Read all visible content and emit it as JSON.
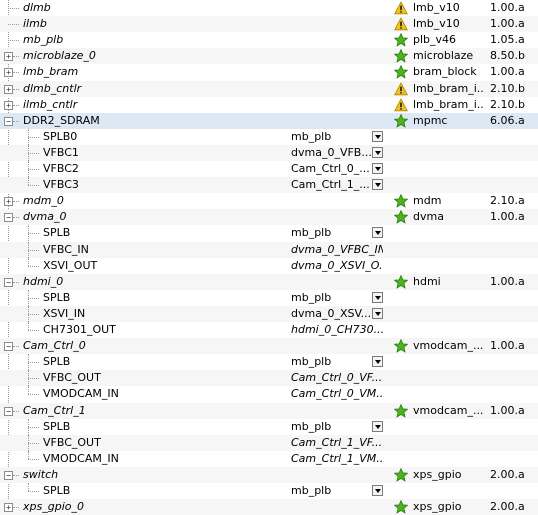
{
  "colors": {
    "star_fill": "#4bb41e",
    "star_stroke": "#2b7a0b",
    "warn_fill": "#f2c21b",
    "warn_stroke": "#b0860a",
    "selected_row": "#dde8f5"
  },
  "rows": [
    {
      "name": "dlmb",
      "italic": true,
      "level": 0,
      "expander": false,
      "status": "warning",
      "ip": "lmb_v10",
      "version": "1.00.a"
    },
    {
      "name": "ilmb",
      "italic": true,
      "level": 0,
      "expander": false,
      "status": "warning",
      "ip": "lmb_v10",
      "version": "1.00.a"
    },
    {
      "name": "mb_plb",
      "italic": true,
      "level": 0,
      "expander": false,
      "status": "star",
      "ip": "plb_v46",
      "version": "1.05.a"
    },
    {
      "name": "microblaze_0",
      "italic": true,
      "level": 0,
      "expander": true,
      "status": "star",
      "ip": "microblaze",
      "version": "8.50.b"
    },
    {
      "name": "lmb_bram",
      "italic": true,
      "level": 0,
      "expander": true,
      "status": "star",
      "ip": "bram_block",
      "version": "1.00.a"
    },
    {
      "name": "dlmb_cntlr",
      "italic": true,
      "level": 0,
      "expander": true,
      "status": "warning",
      "ip": "lmb_bram_i...",
      "version": "2.10.b"
    },
    {
      "name": "ilmb_cntlr",
      "italic": true,
      "level": 0,
      "expander": true,
      "status": "warning",
      "ip": "lmb_bram_i...",
      "version": "2.10.b"
    },
    {
      "name": "DDR2_SDRAM",
      "italic": false,
      "level": 0,
      "expander": true,
      "expanded": true,
      "status": "star",
      "ip": "mpmc",
      "version": "6.06.a",
      "selected": true
    },
    {
      "name": "SPLB0",
      "level": 1,
      "bus": "mb_plb",
      "dropdown": true
    },
    {
      "name": "VFBC1",
      "level": 1,
      "bus": "dvma_0_VFB...",
      "dropdown": true
    },
    {
      "name": "VFBC2",
      "level": 1,
      "bus": "Cam_Ctrl_0_...",
      "dropdown": true
    },
    {
      "name": "VFBC3",
      "level": 1,
      "bus": "Cam_Ctrl_1_...",
      "dropdown": true,
      "last": true
    },
    {
      "name": "mdm_0",
      "italic": true,
      "level": 0,
      "expander": true,
      "status": "star",
      "ip": "mdm",
      "version": "2.10.a"
    },
    {
      "name": "dvma_0",
      "italic": true,
      "level": 0,
      "expander": true,
      "expanded": true,
      "status": "star",
      "ip": "dvma",
      "version": "1.00.a"
    },
    {
      "name": "SPLB",
      "level": 1,
      "bus": "mb_plb",
      "dropdown": true
    },
    {
      "name": "VFBC_IN",
      "level": 1,
      "bus": "dvma_0_VFBC_IN",
      "bus_italic": true
    },
    {
      "name": "XSVI_OUT",
      "level": 1,
      "bus": "dvma_0_XSVI_O...",
      "bus_italic": true,
      "last": true
    },
    {
      "name": "hdmi_0",
      "italic": true,
      "level": 0,
      "expander": true,
      "expanded": true,
      "status": "star",
      "ip": "hdmi",
      "version": "1.00.a"
    },
    {
      "name": "SPLB",
      "level": 1,
      "bus": "mb_plb",
      "dropdown": true
    },
    {
      "name": "XSVI_IN",
      "level": 1,
      "bus": "dvma_0_XSV...",
      "dropdown": true
    },
    {
      "name": "CH7301_OUT",
      "level": 1,
      "bus": "hdmi_0_CH730...",
      "bus_italic": true,
      "last": true
    },
    {
      "name": "Cam_Ctrl_0",
      "italic": true,
      "level": 0,
      "expander": true,
      "expanded": true,
      "status": "star",
      "ip": "vmodcam_...",
      "version": "1.00.a"
    },
    {
      "name": "SPLB",
      "level": 1,
      "bus": "mb_plb",
      "dropdown": true
    },
    {
      "name": "VFBC_OUT",
      "level": 1,
      "bus": "Cam_Ctrl_0_VF...",
      "bus_italic": true
    },
    {
      "name": "VMODCAM_IN",
      "level": 1,
      "bus": "Cam_Ctrl_0_VM...",
      "bus_italic": true,
      "last": true
    },
    {
      "name": "Cam_Ctrl_1",
      "italic": true,
      "level": 0,
      "expander": true,
      "expanded": true,
      "status": "star",
      "ip": "vmodcam_...",
      "version": "1.00.a"
    },
    {
      "name": "SPLB",
      "level": 1,
      "bus": "mb_plb",
      "dropdown": true
    },
    {
      "name": "VFBC_OUT",
      "level": 1,
      "bus": "Cam_Ctrl_1_VF...",
      "bus_italic": true
    },
    {
      "name": "VMODCAM_IN",
      "level": 1,
      "bus": "Cam_Ctrl_1_VM...",
      "bus_italic": true,
      "last": true
    },
    {
      "name": "switch",
      "italic": true,
      "level": 0,
      "expander": true,
      "expanded": true,
      "status": "star",
      "ip": "xps_gpio",
      "version": "2.00.a"
    },
    {
      "name": "SPLB",
      "level": 1,
      "bus": "mb_plb",
      "dropdown": true,
      "last": true
    },
    {
      "name": "xps_gpio_0",
      "italic": true,
      "level": 0,
      "expander": true,
      "status": "star",
      "ip": "xps_gpio",
      "version": "2.00.a"
    }
  ]
}
